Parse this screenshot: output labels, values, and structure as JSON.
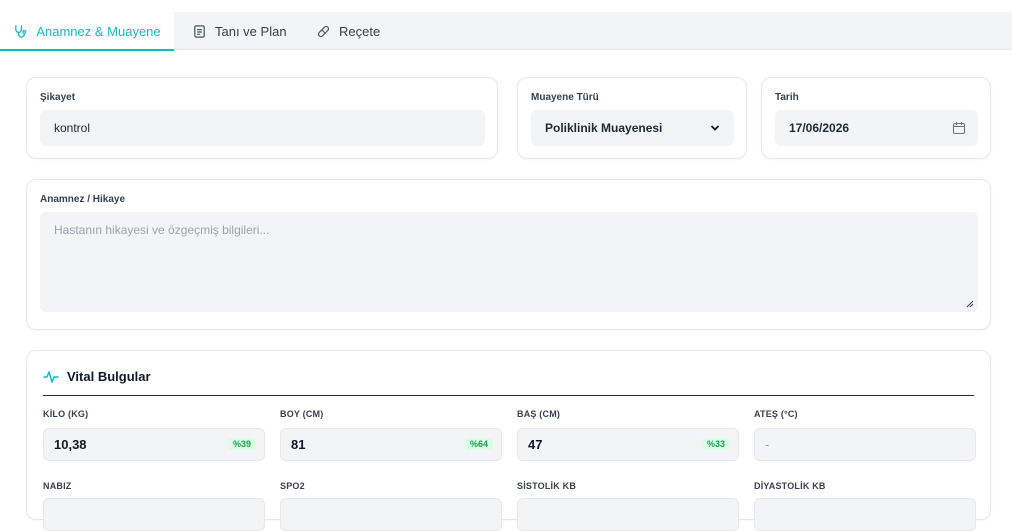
{
  "tabs": [
    {
      "label": "Anamnez & Muayene",
      "icon": "stethoscope-icon",
      "active": true
    },
    {
      "label": "Tanı ve Plan",
      "icon": "document-icon",
      "active": false
    },
    {
      "label": "Reçete",
      "icon": "pill-icon",
      "active": false
    }
  ],
  "complaint": {
    "label": "Şikayet",
    "value": "kontrol"
  },
  "exam_type": {
    "label": "Muayene Türü",
    "value": "Poliklinik Muayenesi"
  },
  "date": {
    "label": "Tarih",
    "value": "17/06/2026"
  },
  "history": {
    "label": "Anamnez / Hikaye",
    "placeholder": "Hastanın hikayesi ve özgeçmiş bilgileri..."
  },
  "vitals": {
    "title": "Vital Bulgular",
    "fields": [
      {
        "label": "KİLO (KG)",
        "value": "10,38",
        "badge": "%39"
      },
      {
        "label": "BOY (CM)",
        "value": "81",
        "badge": "%64"
      },
      {
        "label": "BAŞ (CM)",
        "value": "47",
        "badge": "%33"
      },
      {
        "label": "ATEŞ (°C)",
        "value": "-",
        "badge": ""
      },
      {
        "label": "NABIZ",
        "value": "",
        "badge": ""
      },
      {
        "label": "SPO2",
        "value": "",
        "badge": ""
      },
      {
        "label": "SİSTOLİK KB",
        "value": "",
        "badge": ""
      },
      {
        "label": "DİYASTOLİK KB",
        "value": "",
        "badge": ""
      }
    ]
  },
  "colors": {
    "accent": "#14b8c6",
    "badge_green": "#16a34a"
  }
}
